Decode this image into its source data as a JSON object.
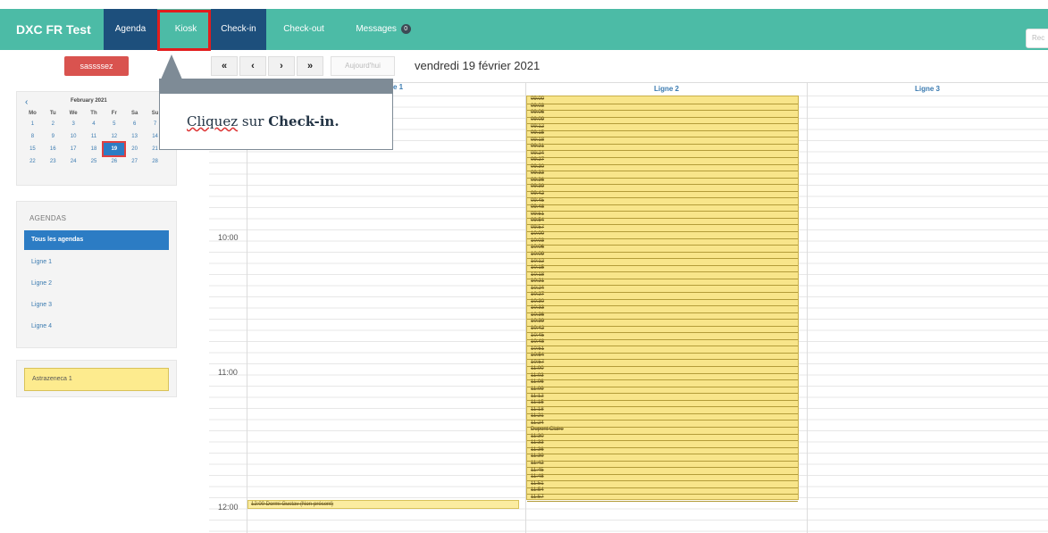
{
  "navbar": {
    "brand": "DXC FR Test",
    "items": [
      {
        "label": "Agenda"
      },
      {
        "label": "Kiosk"
      },
      {
        "label": "Check-in"
      },
      {
        "label": "Check-out"
      },
      {
        "label": "Messages",
        "badge": "0"
      }
    ],
    "search_placeholder": "Rec"
  },
  "sidebar": {
    "action_button": "sassssez",
    "mini_calendar": {
      "month": "February 2021",
      "weekdays": [
        "Mo",
        "Tu",
        "We",
        "Th",
        "Fr",
        "Sa",
        "Su"
      ],
      "weeks": [
        [
          "1",
          "2",
          "3",
          "4",
          "5",
          "6",
          "7"
        ],
        [
          "8",
          "9",
          "10",
          "11",
          "12",
          "13",
          "14"
        ],
        [
          "15",
          "16",
          "17",
          "18",
          "19",
          "20",
          "21"
        ],
        [
          "22",
          "23",
          "24",
          "25",
          "26",
          "27",
          "28"
        ]
      ],
      "selected_day": "19"
    },
    "agendas": {
      "title": "AGENDAS",
      "all_label": "Tous les agendas",
      "lines": [
        "Ligne 1",
        "Ligne 2",
        "Ligne 3",
        "Ligne 4"
      ]
    },
    "event_label": "Astrazeneca 1"
  },
  "toolbar": {
    "first_label": "«",
    "prev_label": "‹",
    "next_label": "›",
    "last_label": "»",
    "today_label": "Aujourd'hui",
    "date_title": "vendredi 19 février 2021"
  },
  "calendar": {
    "columns": [
      "Ligne 1",
      "Ligne 2",
      "Ligne 3"
    ],
    "visible_col1_fragment": "e 1",
    "times": [
      "10:00",
      "11:00",
      "12:00"
    ],
    "slots_1": [
      "09:00",
      "09:03",
      "09:06",
      "09:09",
      "09:12",
      "09:15",
      "09:18",
      "09:21",
      "09:24",
      "09:27",
      "09:30",
      "09:33",
      "09:36",
      "09:39",
      "09:42",
      "09:45",
      "09:48",
      "09:51",
      "09:54",
      "09:57",
      "10:00",
      "10:03",
      "10:06",
      "10:09",
      "10:12",
      "10:15",
      "10:18",
      "10:21",
      "10:24",
      "10:27",
      "10:30",
      "10:33",
      "10:36",
      "10:39",
      "10:42",
      "10:45",
      "10:48",
      "10:51",
      "10:54",
      "10:57",
      "11:00",
      "11:03",
      "11:06",
      "11:09",
      "11:12",
      "11:15",
      "11:18",
      "11:21",
      "11:24"
    ],
    "booked_slot": "Dupont Claire",
    "slots_2": [
      "11:30",
      "11:33",
      "11:36",
      "11:39",
      "11:42",
      "11:45",
      "11:48",
      "11:51",
      "11:54",
      "11:57"
    ],
    "event_bar": "12:00 Dormi Gustav (Non-présent)"
  },
  "callout": {
    "word1": "Cliquez",
    "middle": " sur ",
    "bold": "Check-in."
  },
  "colors": {
    "navbar": "#4cbba6",
    "nav_active": "#1d4f7c",
    "highlight": "#e21d1d",
    "slot": "#f8e58a",
    "link": "#3a7ab0"
  }
}
